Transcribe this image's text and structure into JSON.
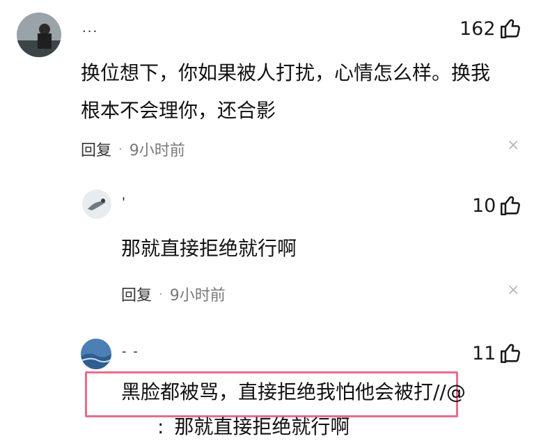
{
  "comments": [
    {
      "username": "...",
      "likes": "162",
      "text_lines": [
        "换位想下，你如果被人打扰，心情怎么样。换我",
        "根本不会理你，还合影"
      ],
      "reply_label": "回复",
      "separator": "·",
      "time": "9小时前",
      "close_symbol": "×"
    },
    {
      "username": "'",
      "likes": "10",
      "text": "那就直接拒绝就行啊",
      "reply_label": "回复",
      "separator": "·",
      "time": "9小时前",
      "close_symbol": "×"
    },
    {
      "username": "- -",
      "likes": "11",
      "text": "黑脸都被骂，直接拒绝我怕他会被打//@",
      "quote_prefix": ":",
      "quote_text": "那就直接拒绝就行啊"
    }
  ],
  "colors": {
    "highlight_border": "#e96b8c",
    "meta_text": "#777777",
    "close": "#b8b8b8"
  },
  "icons": {
    "like": "thumbs-up-icon",
    "close": "close-icon"
  }
}
